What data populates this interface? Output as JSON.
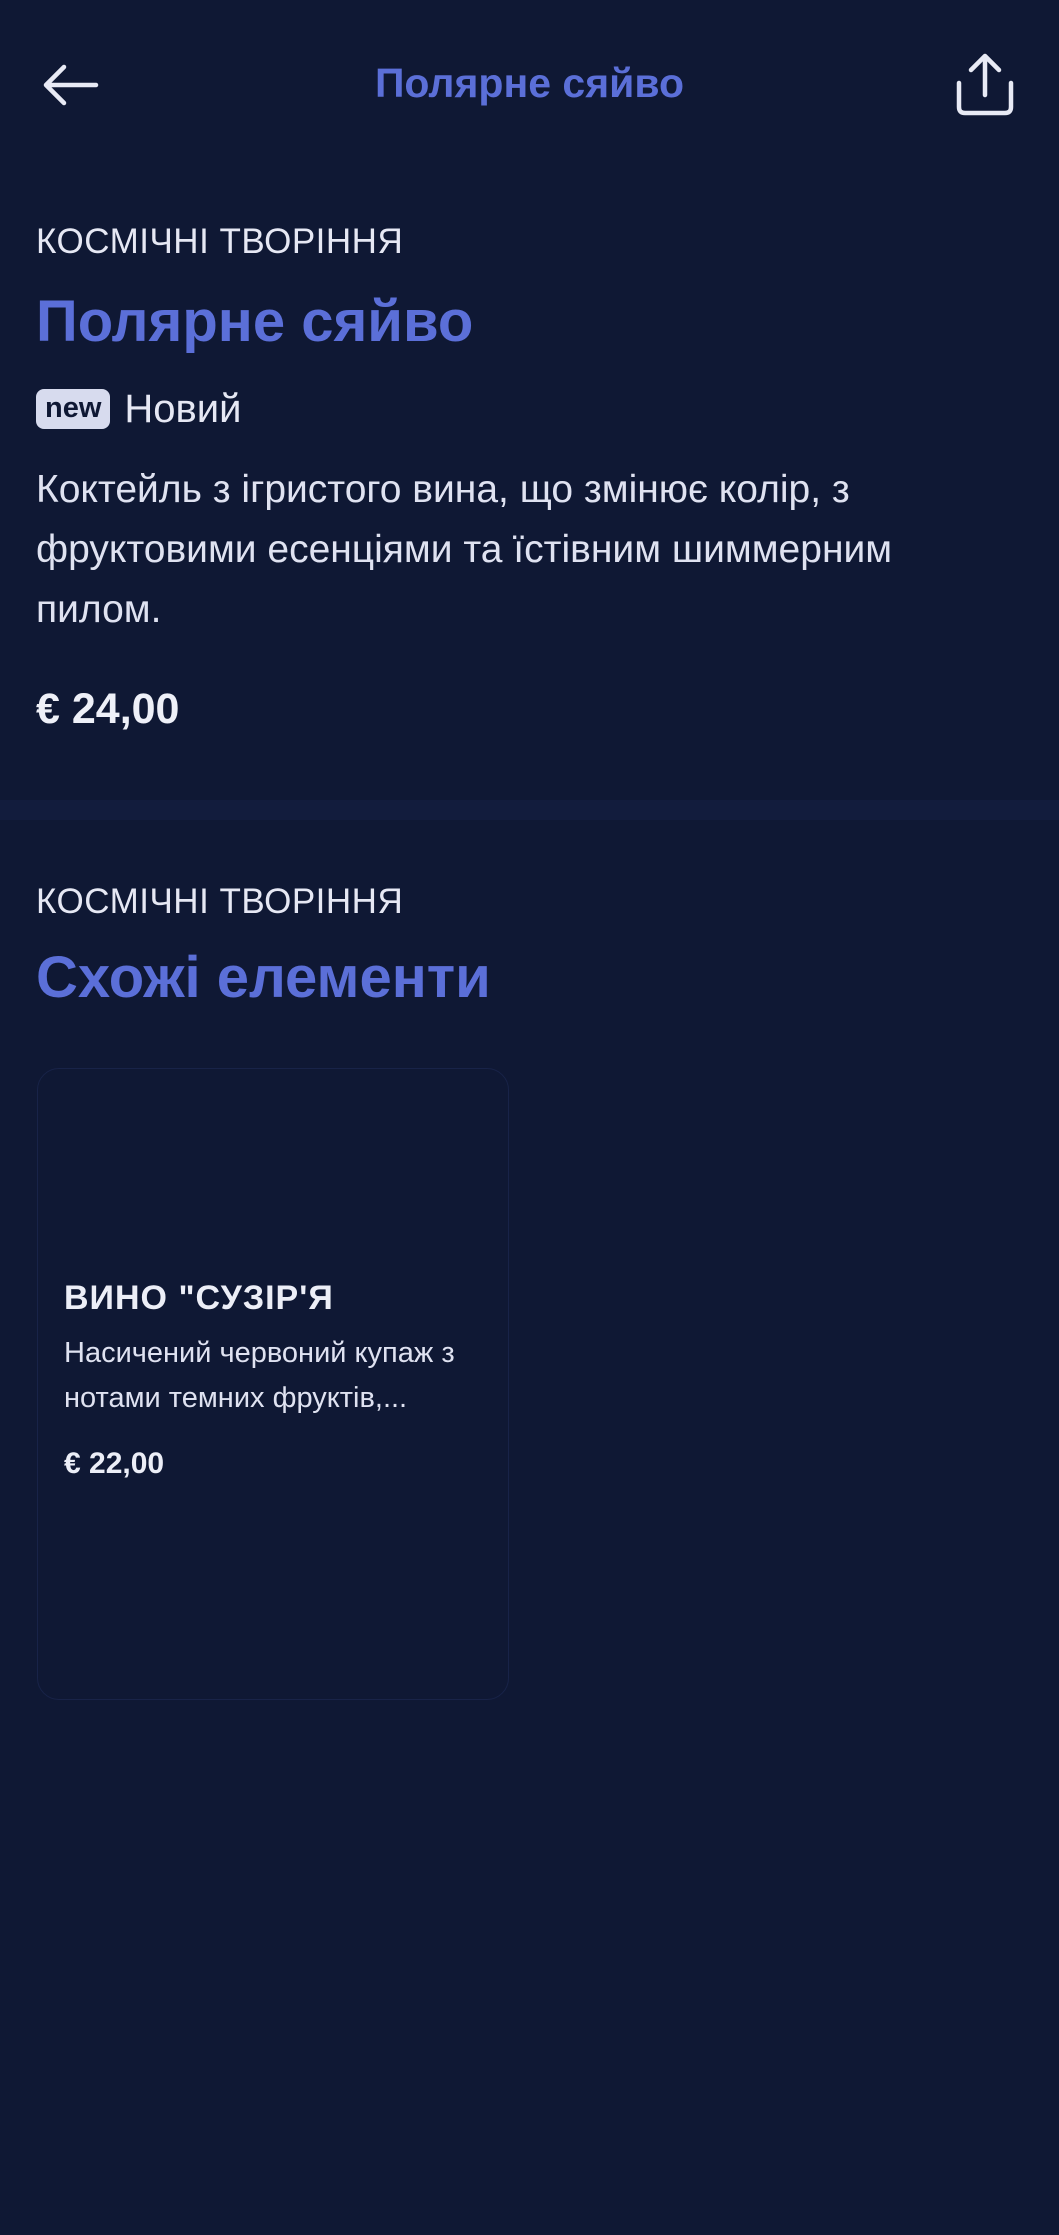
{
  "header": {
    "title": "Полярне сяйво",
    "back_icon": "arrow-left-icon",
    "share_icon": "share-icon"
  },
  "item": {
    "category": "КОСМІЧНІ ТВОРІННЯ",
    "name": "Полярне сяйво",
    "badge": "new",
    "badge_label": "Новий",
    "description": "Коктейль з ігристого вина, що змінює колір, з фруктовими есенціями та їстівним шиммерним пилом.",
    "price": "€ 24,00"
  },
  "similar": {
    "category": "КОСМІЧНІ ТВОРІННЯ",
    "title": "Схожі елементи",
    "items": [
      {
        "name": "ВИНО \"СУЗІР'Я",
        "description": "Насичений червоний купаж з нотами темних фруктів,...",
        "price": "€ 22,00"
      }
    ]
  },
  "colors": {
    "background": "#0f1834",
    "accent": "#5b6fd8",
    "text": "#e6e8f4",
    "badge_bg": "#d7dbee"
  }
}
